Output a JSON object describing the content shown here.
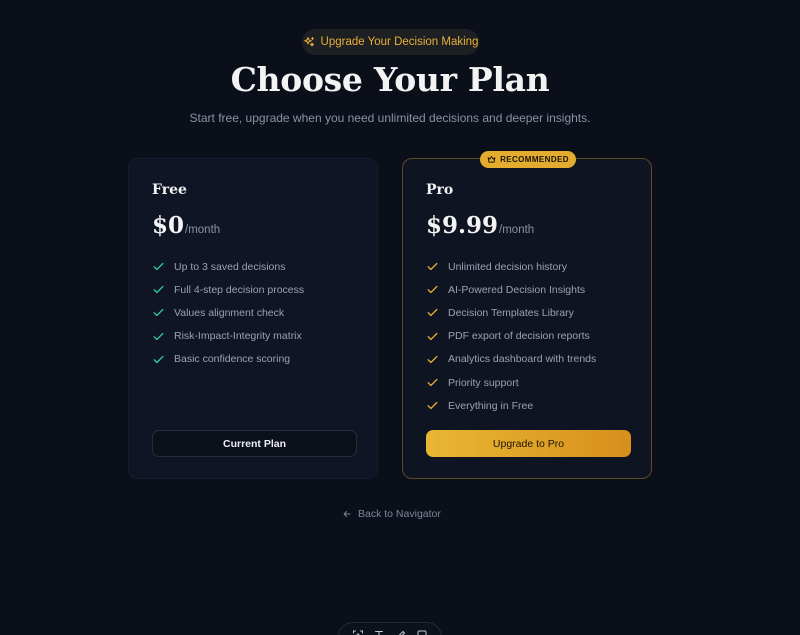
{
  "header": {
    "badge_label": "Upgrade Your Decision Making",
    "badge_icon": "sparkles-icon",
    "title": "Choose Your Plan",
    "subtitle": "Start free, upgrade when you need unlimited decisions and deeper insights."
  },
  "plans": {
    "free": {
      "name": "Free",
      "price": "$0",
      "period": "/month",
      "features": [
        "Up to 3 saved decisions",
        "Full 4-step decision process",
        "Values alignment check",
        "Risk-Impact-Integrity matrix",
        "Basic confidence scoring"
      ],
      "button_label": "Current Plan",
      "check_color": "#34c79a"
    },
    "pro": {
      "badge": "RECOMMENDED",
      "badge_icon": "crown-icon",
      "name": "Pro",
      "price": "$9.99",
      "period": "/month",
      "features": [
        "Unlimited decision history",
        "AI-Powered Decision Insights",
        "Decision Templates Library",
        "PDF export of decision reports",
        "Analytics dashboard with trends",
        "Priority support",
        "Everything in Free"
      ],
      "button_label": "Upgrade to Pro",
      "check_color": "#e3ac2e"
    }
  },
  "footer": {
    "back_label": "Back to Navigator"
  },
  "toolbar": {
    "tools": [
      "select-area-icon",
      "text-icon",
      "pen-icon",
      "shape-icon"
    ]
  },
  "colors": {
    "background": "#0a0f1a",
    "accent_gold": "#e3ac2e",
    "accent_green": "#34c79a"
  }
}
